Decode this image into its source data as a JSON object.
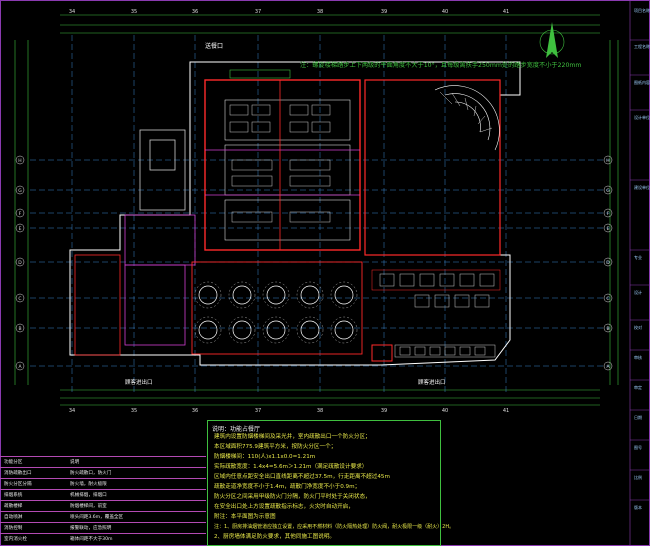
{
  "drawing": {
    "top_note": "注：螺旋楼梯踏步上下两级的平面角度不大于10°，且每级离扶手250mm处的踏步宽度不小于220mm",
    "labels": {
      "top_entrance": "送餐口",
      "bottom_left_entrance": "顾客进出口",
      "bottom_right_entrance": "顾客进出口"
    }
  },
  "grid_labels": {
    "columns": [
      "34",
      "35",
      "36",
      "37",
      "38",
      "39",
      "40",
      "41"
    ],
    "rows": [
      "H",
      "G",
      "F",
      "E",
      "D",
      "C",
      "B",
      "A"
    ]
  },
  "notes": {
    "title": "说明：功能占餐厅",
    "lines": [
      "建筑内设置防烟楼梯间及采光井，室内疏散出口一个防火分区；",
      "本区域面积775.9建筑平方米，按防火分区一个；",
      "防烟楼梯间：110(人)x1.1x0.0=1.21m",
      "实际疏散宽度：1.4x4=5.6m＞1.21m（满足疏散设计要求）",
      "区域内任意点距安全出口直线距离不超过37.5m，行走距离不超过45m",
      "疏散走道净宽度不小于1.4m，疏散门净宽度不小于0.9m；",
      "防火分区之间采用甲级防火门分隔，防火门平时处于关闭状态，",
      "在安全出口处上方设置疏散指示标志，火灾时自动开启，",
      "附注：本平面图为示意图",
      "注：1、厨房排油烟管道应独立设置，应采用不燃材料（防火隔热处理）防火阀，耐火极限一级（耐火）2H。",
      "2、厨房墙体满足防火要求，其他同施工图说明。"
    ]
  },
  "legend": {
    "rows": [
      {
        "a": "功能分区",
        "b": "说明"
      },
      {
        "a": "消防疏散出口",
        "b": "防火疏散口，防火门"
      },
      {
        "a": "防火分区分隔",
        "b": "防火墙，耐火极限"
      },
      {
        "a": "排烟系统",
        "b": "机械排烟，排烟口"
      },
      {
        "a": "疏散楼梯",
        "b": "防烟楼梯间，前室"
      },
      {
        "a": "自动喷淋",
        "b": "喷头间距3.6m，覆盖全区"
      },
      {
        "a": "消防控制",
        "b": "报警联动，应急照明"
      },
      {
        "a": "室内消火栓",
        "b": "箱体间距不大于30m"
      }
    ]
  },
  "right_panel": {
    "items": [
      "项目名称",
      "工程名称",
      "图纸内容",
      "设计单位",
      "建设单位",
      "专业",
      "设计",
      "校对",
      "审核",
      "审定",
      "日期",
      "图号",
      "比例",
      "版本"
    ]
  },
  "colors": {
    "wall_red": "#ff2a2a",
    "furniture": "#ffffff",
    "dimension": "#3fbf3f",
    "grid": "#4aa6ff",
    "notes_text": "#e8e84a",
    "magenta": "#d23fd2"
  },
  "icons": [
    "north-arrow-icon"
  ]
}
